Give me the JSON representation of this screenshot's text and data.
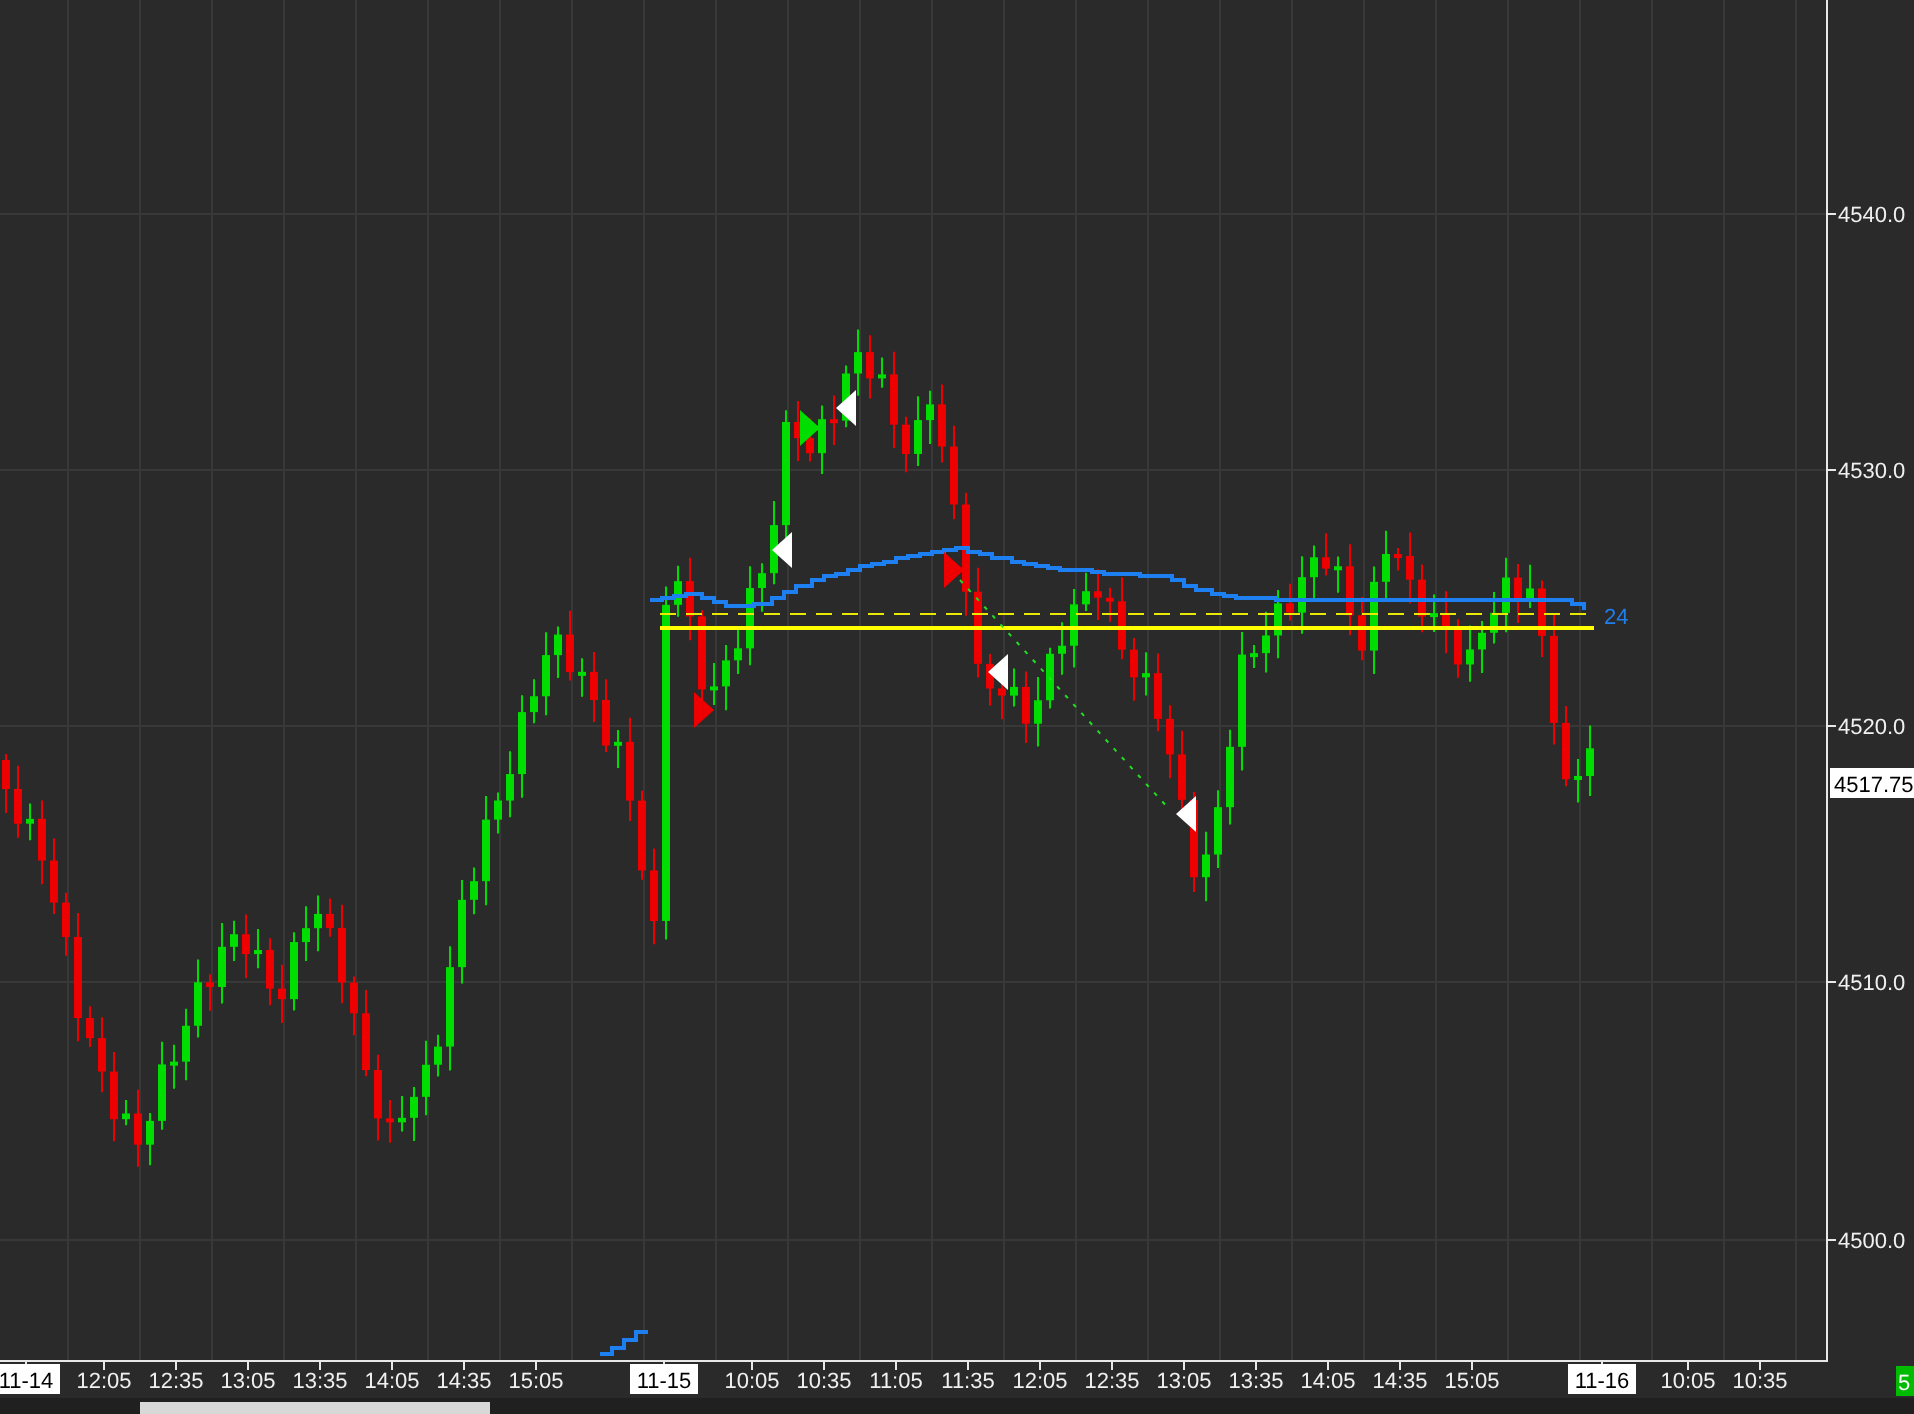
{
  "chart": {
    "y_axis_labels": [
      "4540.0",
      "4530.0",
      "4520.0",
      "4510.0",
      "4500.0"
    ],
    "x_axis_labels": [
      {
        "text": "11-14",
        "kind": "date"
      },
      {
        "text": "12:05",
        "kind": "time"
      },
      {
        "text": "12:35",
        "kind": "time"
      },
      {
        "text": "13:05",
        "kind": "time"
      },
      {
        "text": "13:35",
        "kind": "time"
      },
      {
        "text": "14:05",
        "kind": "time"
      },
      {
        "text": "14:35",
        "kind": "time"
      },
      {
        "text": "15:05",
        "kind": "time"
      },
      {
        "text": "11-15",
        "kind": "date"
      },
      {
        "text": "10:05",
        "kind": "time"
      },
      {
        "text": "10:35",
        "kind": "time"
      },
      {
        "text": "11:05",
        "kind": "time"
      },
      {
        "text": "11:35",
        "kind": "time"
      },
      {
        "text": "12:05",
        "kind": "time"
      },
      {
        "text": "12:35",
        "kind": "time"
      },
      {
        "text": "13:05",
        "kind": "time"
      },
      {
        "text": "13:35",
        "kind": "time"
      },
      {
        "text": "14:05",
        "kind": "time"
      },
      {
        "text": "14:35",
        "kind": "time"
      },
      {
        "text": "15:05",
        "kind": "time"
      },
      {
        "text": "11-16",
        "kind": "date"
      },
      {
        "text": "10:05",
        "kind": "time"
      },
      {
        "text": "10:35",
        "kind": "time"
      }
    ],
    "last_price": "4517.75",
    "line_label": "24"
  },
  "corner_badge": "5"
}
